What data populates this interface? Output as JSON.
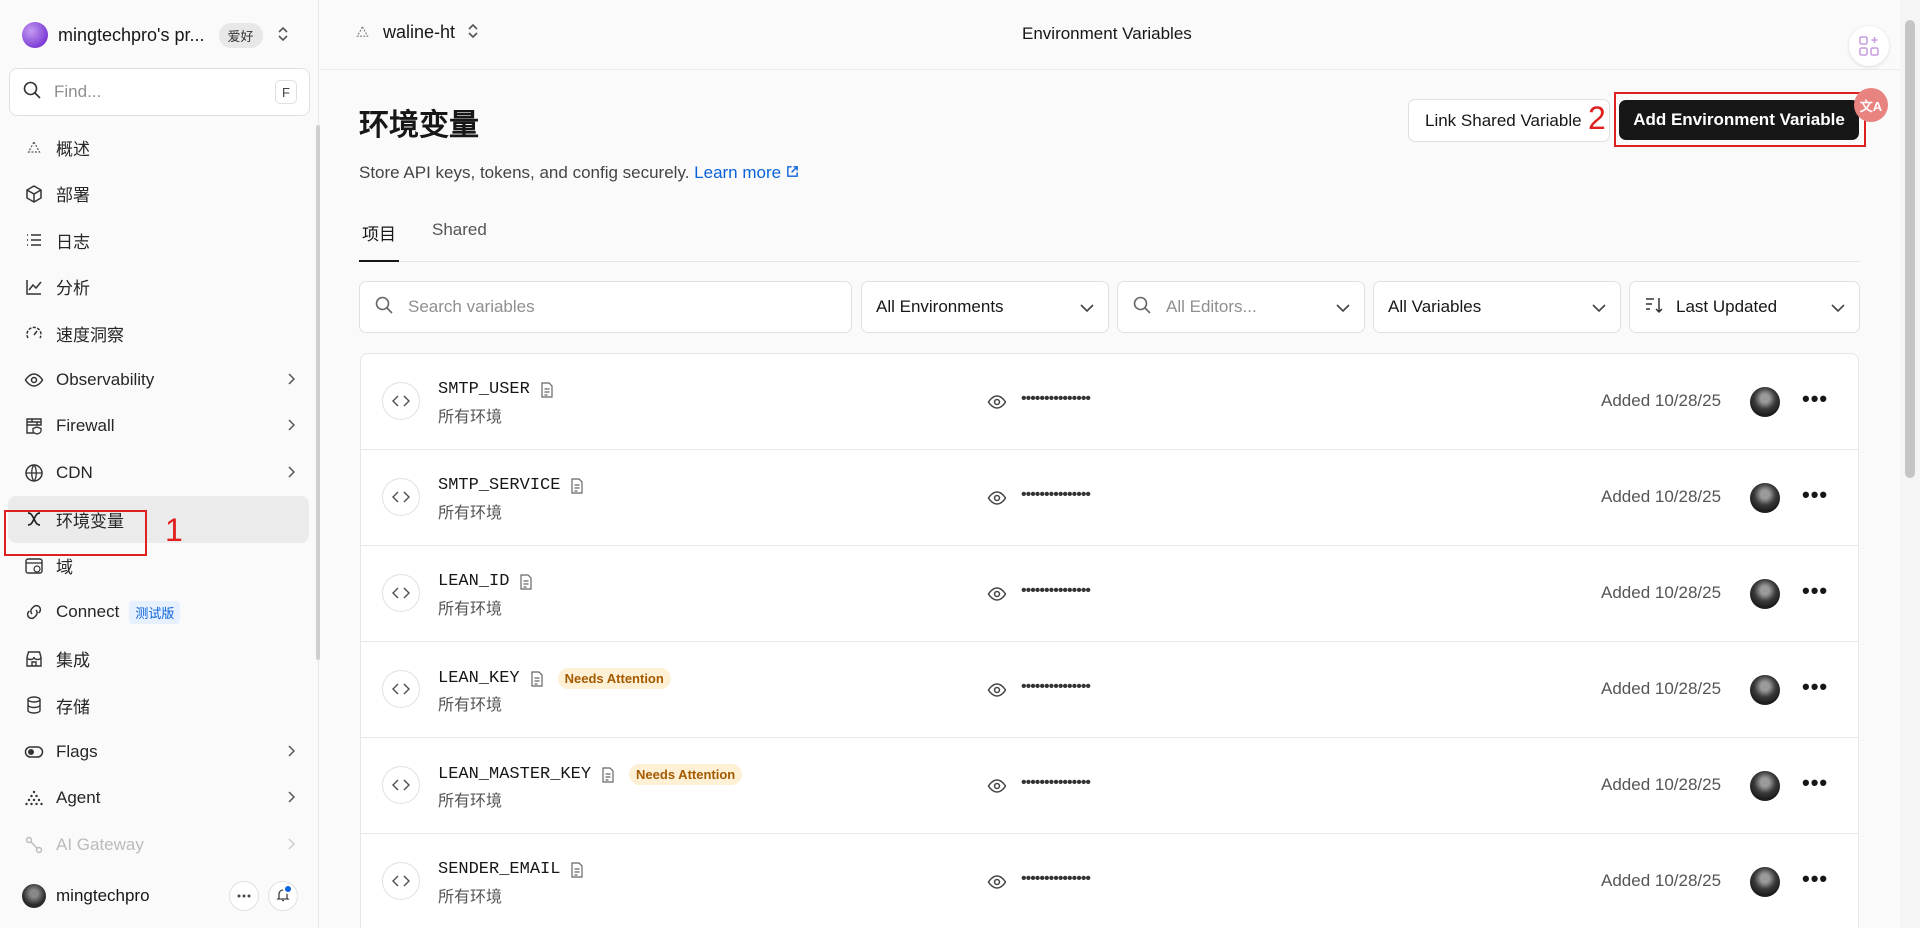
{
  "sidebar": {
    "team_name": "mingtechpro's pr...",
    "team_badge": "爱好",
    "find_placeholder": "Find...",
    "find_shortcut": "F",
    "items": [
      {
        "label": "概述"
      },
      {
        "label": "部署"
      },
      {
        "label": "日志"
      },
      {
        "label": "分析"
      },
      {
        "label": "速度洞察"
      },
      {
        "label": "Observability"
      },
      {
        "label": "Firewall"
      },
      {
        "label": "CDN"
      },
      {
        "label": "环境变量"
      },
      {
        "label": "域"
      },
      {
        "label": "Connect",
        "badge": "测试版"
      },
      {
        "label": "集成"
      },
      {
        "label": "存储"
      },
      {
        "label": "Flags"
      },
      {
        "label": "Agent"
      },
      {
        "label": "AI Gateway"
      }
    ],
    "user_name": "mingtechpro"
  },
  "topbar": {
    "project_name": "waline-ht",
    "title": "Environment Variables"
  },
  "main": {
    "page_title": "环境变量",
    "subtitle": "Store API keys, tokens, and config securely.",
    "learn_more": "Learn more",
    "link_shared_button": "Link Shared Variable",
    "add_button": "Add Environment Variable",
    "tabs": [
      {
        "label": "项目"
      },
      {
        "label": "Shared"
      }
    ],
    "filters": {
      "search_placeholder": "Search variables",
      "environments": "All Environments",
      "editors_placeholder": "All Editors...",
      "variables": "All Variables",
      "sort": "Last Updated"
    },
    "rows": [
      {
        "name": "SMTP_USER",
        "env": "所有环境",
        "value": "•••••••••••••••",
        "added": "Added 10/28/25",
        "badge": ""
      },
      {
        "name": "SMTP_SERVICE",
        "env": "所有环境",
        "value": "•••••••••••••••",
        "added": "Added 10/28/25",
        "badge": ""
      },
      {
        "name": "LEAN_ID",
        "env": "所有环境",
        "value": "•••••••••••••••",
        "added": "Added 10/28/25",
        "badge": ""
      },
      {
        "name": "LEAN_KEY",
        "env": "所有环境",
        "value": "•••••••••••••••",
        "added": "Added 10/28/25",
        "badge": "Needs Attention"
      },
      {
        "name": "LEAN_MASTER_KEY",
        "env": "所有环境",
        "value": "•••••••••••••••",
        "added": "Added 10/28/25",
        "badge": "Needs Attention"
      },
      {
        "name": "SENDER_EMAIL",
        "env": "所有环境",
        "value": "•••••••••••••••",
        "added": "Added 10/28/25",
        "badge": ""
      }
    ]
  },
  "annotations": {
    "step1": "1",
    "step2": "2"
  },
  "colors": {
    "accent_link": "#0a63d8",
    "annotation_red": "#e02020",
    "needs_attention_bg": "#fdf0d5",
    "needs_attention_text": "#a35a00"
  }
}
